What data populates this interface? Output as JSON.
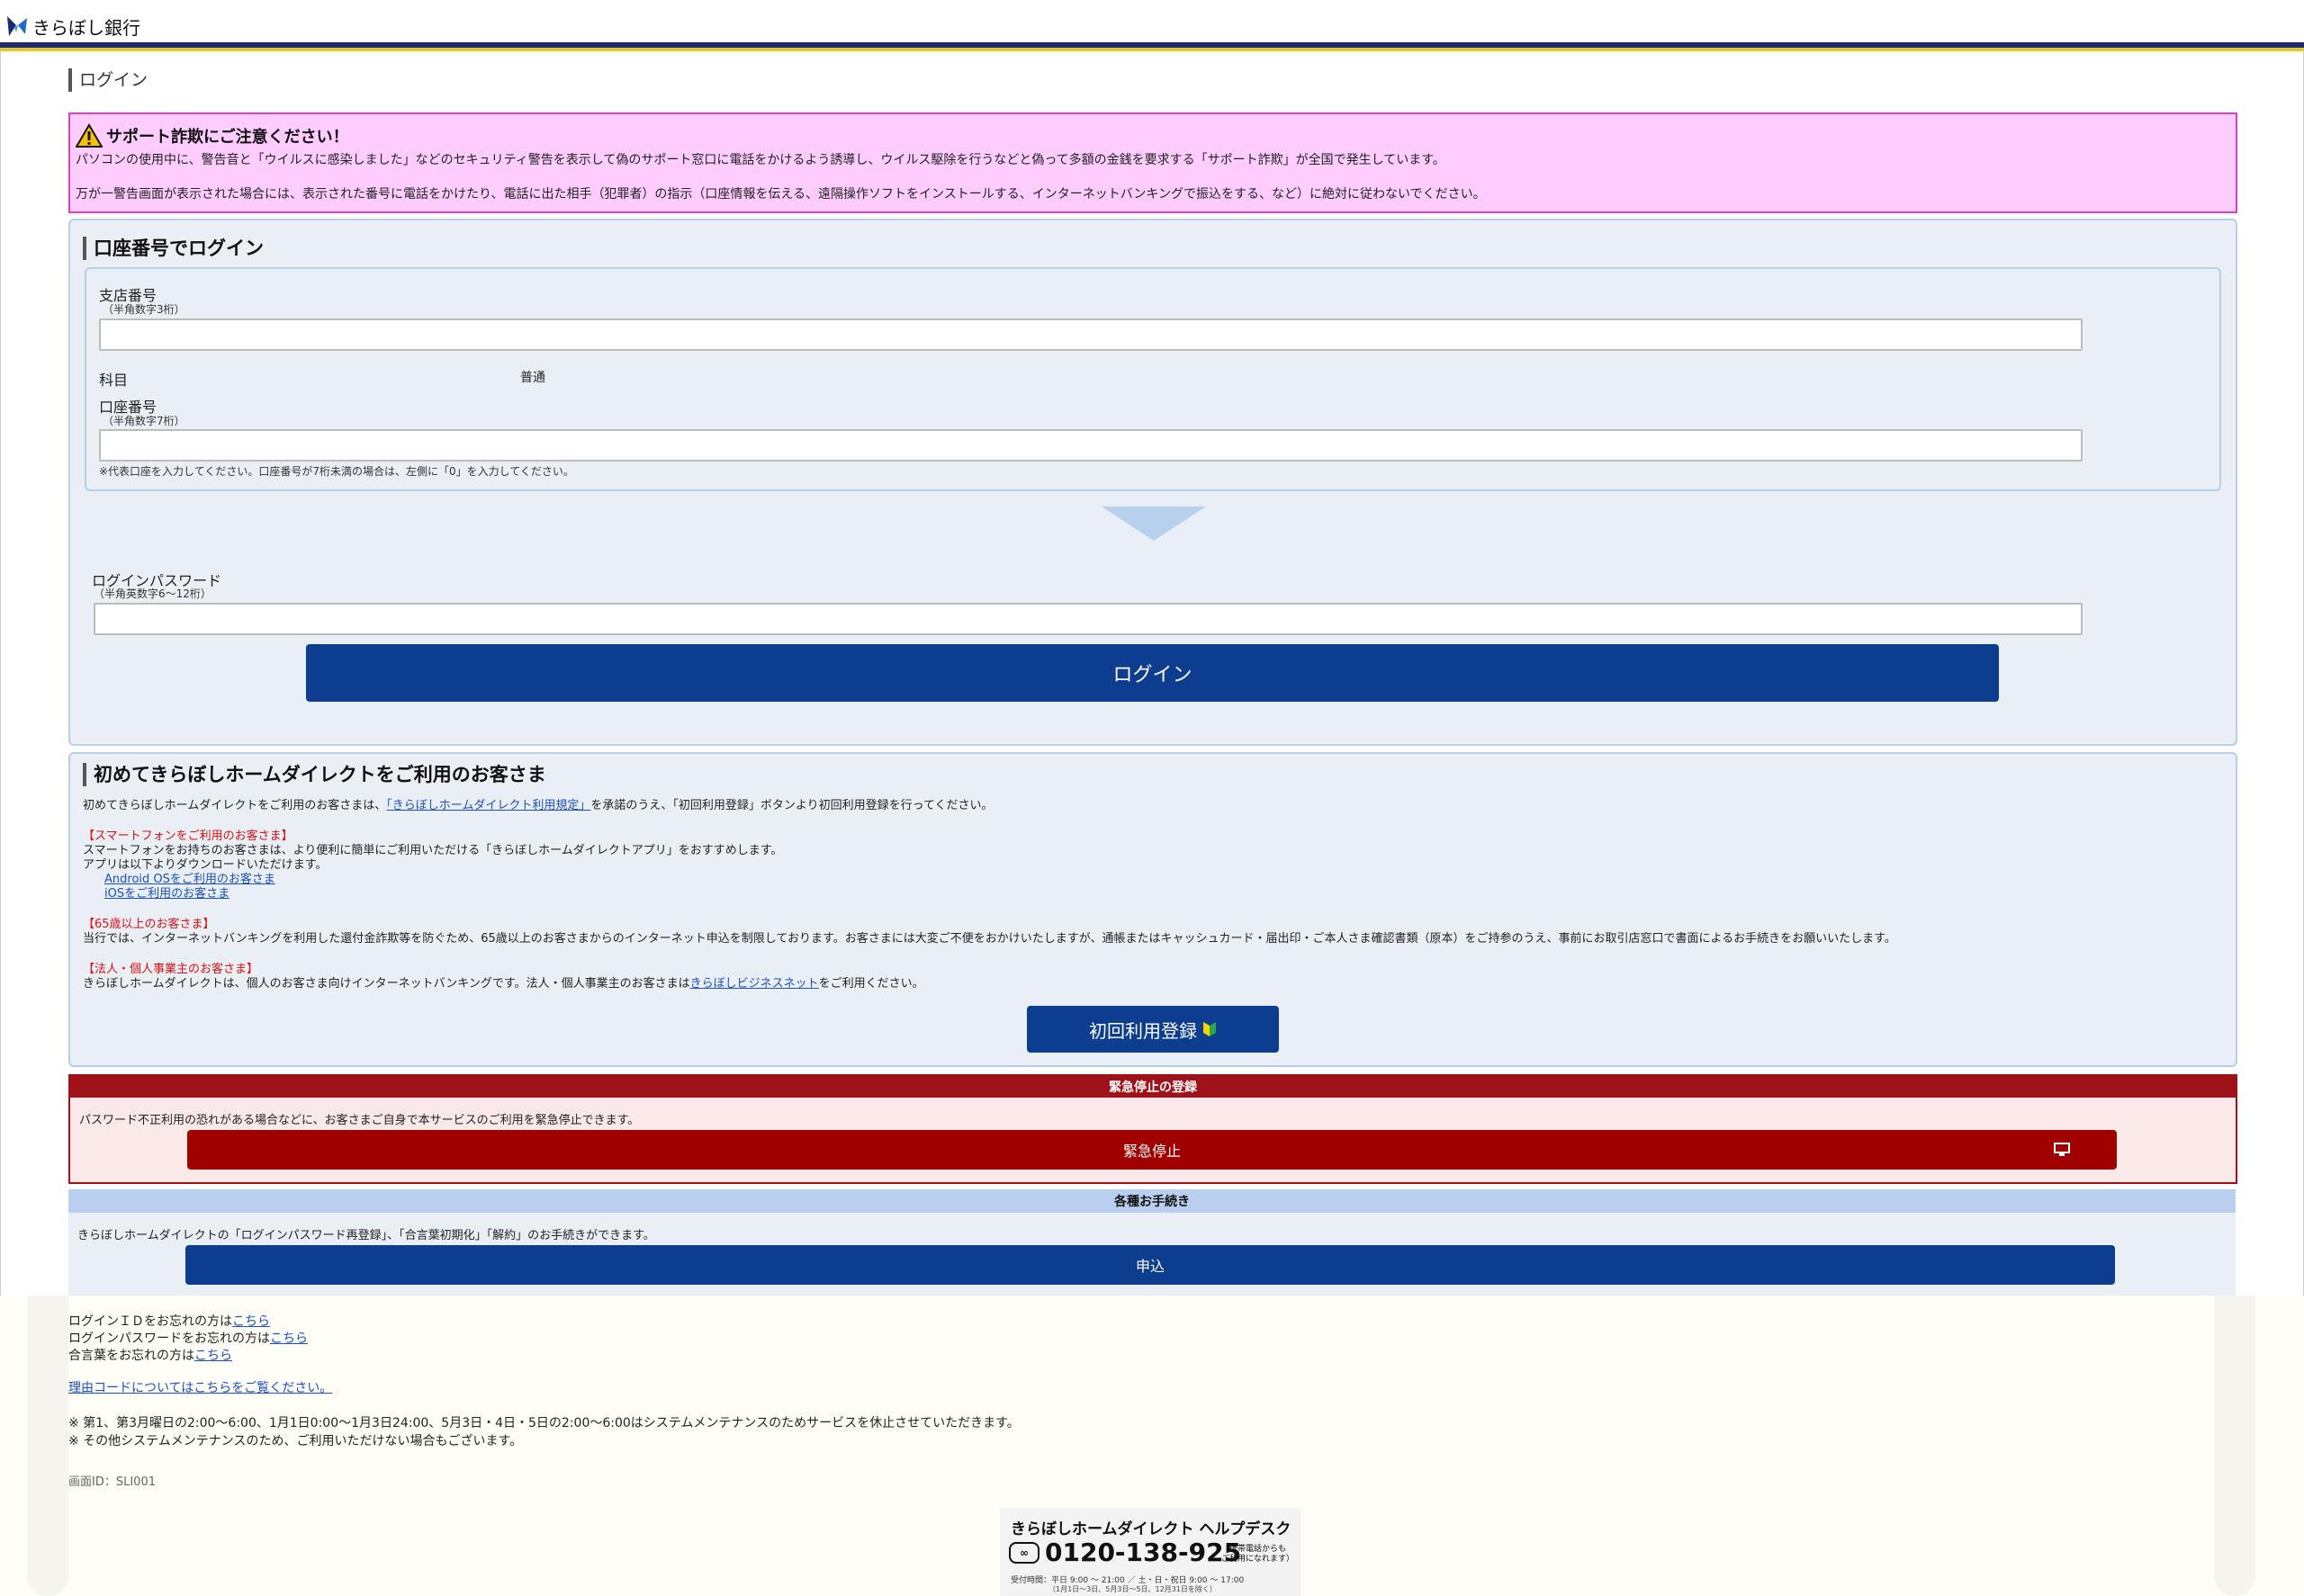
{
  "header": {
    "bank_name": "きらぼし銀行"
  },
  "page_title": "ログイン",
  "warning": {
    "title": "サポート詐欺にご注意ください！",
    "line1": "パソコンの使用中に、警告音と「ウイルスに感染しました」などのセキュリティ警告を表示して偽のサポート窓口に電話をかけるよう誘導し、ウイルス駆除を行うなどと偽って多額の金銭を要求する「サポート詐欺」が全国で発生しています。",
    "line2": "万が一警告画面が表示された場合には、表示された番号に電話をかけたり、電話に出た相手（犯罪者）の指示（口座情報を伝える、遠隔操作ソフトをインストールする、インターネットバンキングで振込をする、など）に絶対に従わないでください。"
  },
  "login": {
    "section_title": "口座番号でログイン",
    "branch_label": "支店番号",
    "branch_hint": "（半角数字3桁）",
    "branch_value": "",
    "subject_label": "科目",
    "subject_value": "普通",
    "account_label": "口座番号",
    "account_hint": "（半角数字7桁）",
    "account_value": "",
    "account_note": "※代表口座を入力してください。口座番号が7桁未満の場合は、左側に「0」を入力してください。",
    "password_label": "ログインパスワード",
    "password_hint": "（半角英数字6～12桁）",
    "password_value": "",
    "login_button": "ログイン"
  },
  "first_time": {
    "section_title": "初めてきらぼしホームダイレクトをご利用のお客さま",
    "intro_before": "初めてきらぼしホームダイレクトをご利用のお客さまは、",
    "intro_link": "「きらぼしホームダイレクト利用規定」",
    "intro_after": "を承諾のうえ、「初回利用登録」ボタンより初回利用登録を行ってください。",
    "smartphone_heading": "【スマートフォンをご利用のお客さま】",
    "smartphone_text1": "スマートフォンをお持ちのお客さまは、より便利に簡単にご利用いただける「きらぼしホームダイレクトアプリ」をおすすめします。",
    "smartphone_text2": "アプリは以下よりダウンロードいただけます。",
    "android_link": "Android OSをご利用のお客さま",
    "ios_link": "iOSをご利用のお客さま",
    "senior_heading": "【65歳以上のお客さま】",
    "senior_text": "当行では、インターネットバンキングを利用した還付金詐欺等を防ぐため、65歳以上のお客さまからのインターネット申込を制限しております。お客さまには大変ご不便をおかけいたしますが、通帳またはキャッシュカード・届出印・ご本人さま確認書類（原本）をご持参のうえ、事前にお取引店窓口で書面によるお手続きをお願いいたします。",
    "corp_heading": "【法人・個人事業主のお客さま】",
    "corp_before": "きらぼしホームダイレクトは、個人のお客さま向けインターネットバンキングです。法人・個人事業主のお客さまは",
    "corp_link": "きらぼしビジネスネット",
    "corp_after": "をご利用ください。",
    "register_button": "初回利用登録"
  },
  "emergency": {
    "header": "緊急停止の登録",
    "text": "パスワード不正利用の恐れがある場合などに、お客さまご自身で本サービスのご利用を緊急停止できます。",
    "button": "緊急停止"
  },
  "procedures": {
    "header": "各種お手続き",
    "text": "きらぼしホームダイレクトの「ログインパスワード再登録」、「合言葉初期化」「解約」のお手続きができます。",
    "button": "申込"
  },
  "footer": {
    "forgot_id_text": "ログインＩＤをお忘れの方は",
    "forgot_password_text": "ログインパスワードをお忘れの方は",
    "forgot_phrase_text": "合言葉をお忘れの方は",
    "here_link": "こちら",
    "reason_code_link": "理由コードについてはこちらをご覧ください。",
    "maintenance_note1": "※ 第1、第3月曜日の2:00～6:00、1月1日0:00～1月3日24:00、5月3日・4日・5日の2:00～6:00はシステムメンテナンスのためサービスを休止させていただきます。",
    "maintenance_note2": "※ その他システムメンテナンスのため、ご利用いただけない場合もございます。",
    "screen_id": "画面ID：SLI001"
  },
  "helpdesk": {
    "title": "きらぼしホームダイレクト ヘルプデスク",
    "phone": "0120-138-925",
    "mobile_note1": "（携帯電話からも",
    "mobile_note2": "ご利用になれます）",
    "hours": "受付時間：平日 9:00 ～ 21:00 ／ 土・日・祝日 9:00 ～ 17:00",
    "hours_note": "（1月1日～3日、5月3日～5日、12月31日を除く）"
  },
  "colors": {
    "primary_button": "#0c3d8f",
    "emergency": "#a0121a",
    "warning_bg": "#ffccff",
    "panel_bg": "#eaeef5",
    "header_bar": "#1b2a78",
    "header_accent": "#e8c820"
  }
}
